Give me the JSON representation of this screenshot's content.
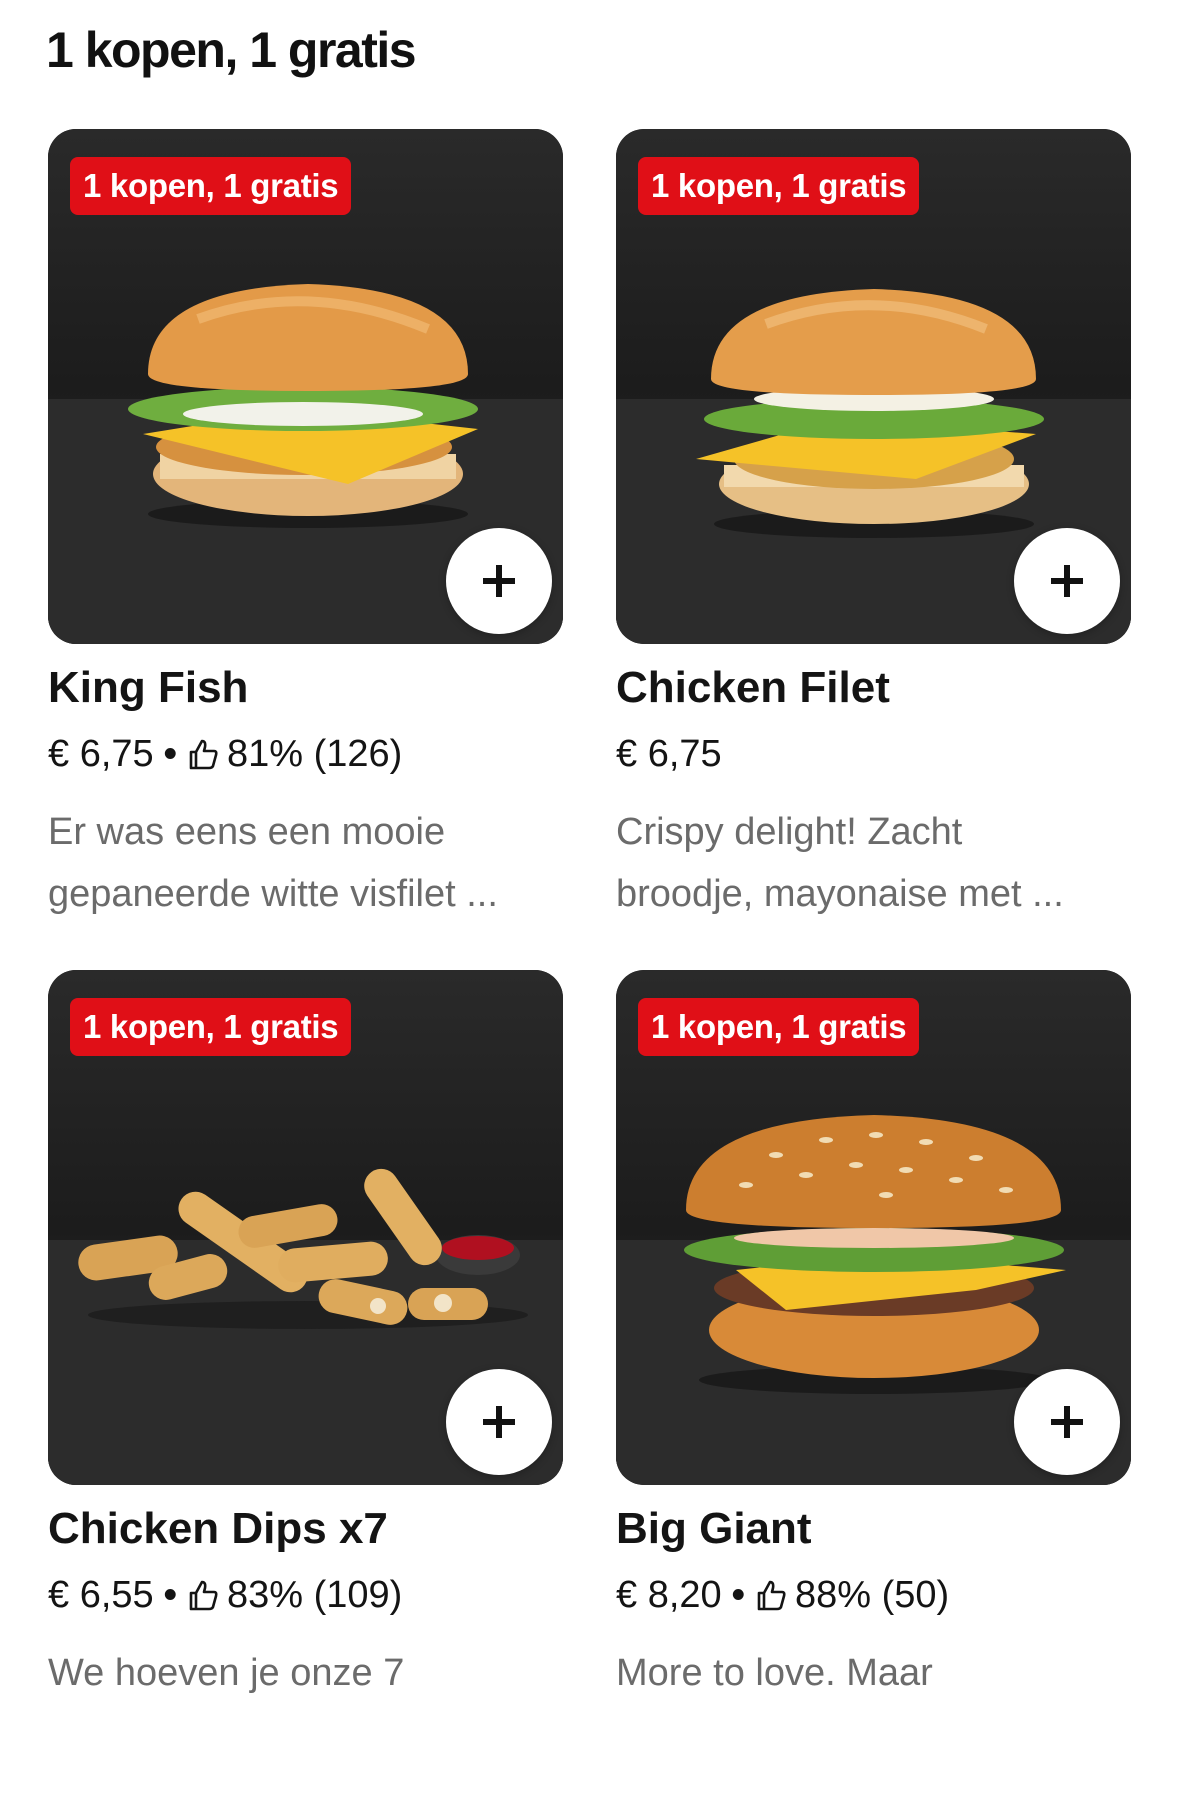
{
  "section": {
    "title": "1 kopen, 1 gratis"
  },
  "items": [
    {
      "name": "King Fish",
      "price": "€ 6,75",
      "rating": "81% (126)",
      "desc_line1": "Er was eens een mooie",
      "desc_line2": "gepaneerde witte visfilet ...",
      "badge": "1 kopen, 1 gratis",
      "image": "fish-burger"
    },
    {
      "name": "Chicken Filet",
      "price": "€ 6,75",
      "rating": "",
      "desc_line1": "Crispy delight! Zacht",
      "desc_line2": "broodje, mayonaise met ...",
      "badge": "1 kopen, 1 gratis",
      "image": "chicken-burger"
    },
    {
      "name": "Chicken Dips x7",
      "price": "€ 6,55",
      "rating": "83% (109)",
      "desc_line1": "We hoeven je onze 7",
      "desc_line2": "",
      "badge": "1 kopen, 1 gratis",
      "image": "chicken-dips"
    },
    {
      "name": "Big Giant",
      "price": "€ 8,20",
      "rating": "88% (50)",
      "desc_line1": "More to love. Maar",
      "desc_line2": "",
      "badge": "1 kopen, 1 gratis",
      "image": "beef-burger"
    }
  ],
  "colors": {
    "promo": "#e00f17",
    "text": "#141414",
    "muted": "#6b6b6b"
  },
  "icons": {
    "add": "plus-icon",
    "rating": "thumbs-up-icon"
  }
}
